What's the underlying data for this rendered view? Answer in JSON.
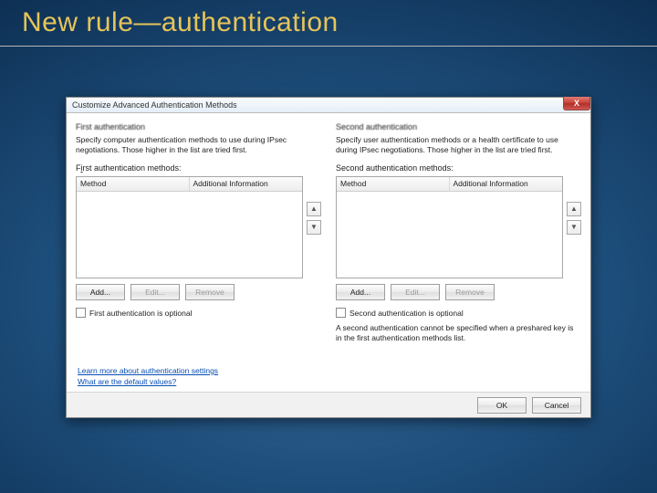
{
  "slide": {
    "title": "New rule—authentication"
  },
  "dialog": {
    "title": "Customize Advanced Authentication Methods",
    "close": "X",
    "first": {
      "heading": "First authentication",
      "desc": "Specify computer authentication methods to use during IPsec negotiations. Those higher in the list are tried first.",
      "list_label_pre": "F",
      "list_label_hot": "i",
      "list_label_post": "rst authentication methods:",
      "col_method": "Method",
      "col_addl": "Additional Information",
      "btn_add": "Add...",
      "btn_edit": "Edit...",
      "btn_remove": "Remove",
      "checkbox": "First authentication is optional"
    },
    "second": {
      "heading": "Second authentication",
      "desc": "Specify user authentication methods or a health certificate to use during IPsec negotiations. Those higher in the list are tried first.",
      "list_label": "Second authentication methods:",
      "col_method": "Method",
      "col_addl": "Additional Information",
      "btn_add": "Add...",
      "btn_edit": "Edit...",
      "btn_remove": "Remove",
      "checkbox": "Second authentication is optional",
      "note": "A second authentication cannot be specified when a preshared key is in the first authentication methods list."
    },
    "links": {
      "learn": "Learn more about authentication settings",
      "defaults": "What are the default values?"
    },
    "footer": {
      "ok": "OK",
      "cancel": "Cancel"
    },
    "glyphs": {
      "up": "▲",
      "down": "▼"
    }
  }
}
